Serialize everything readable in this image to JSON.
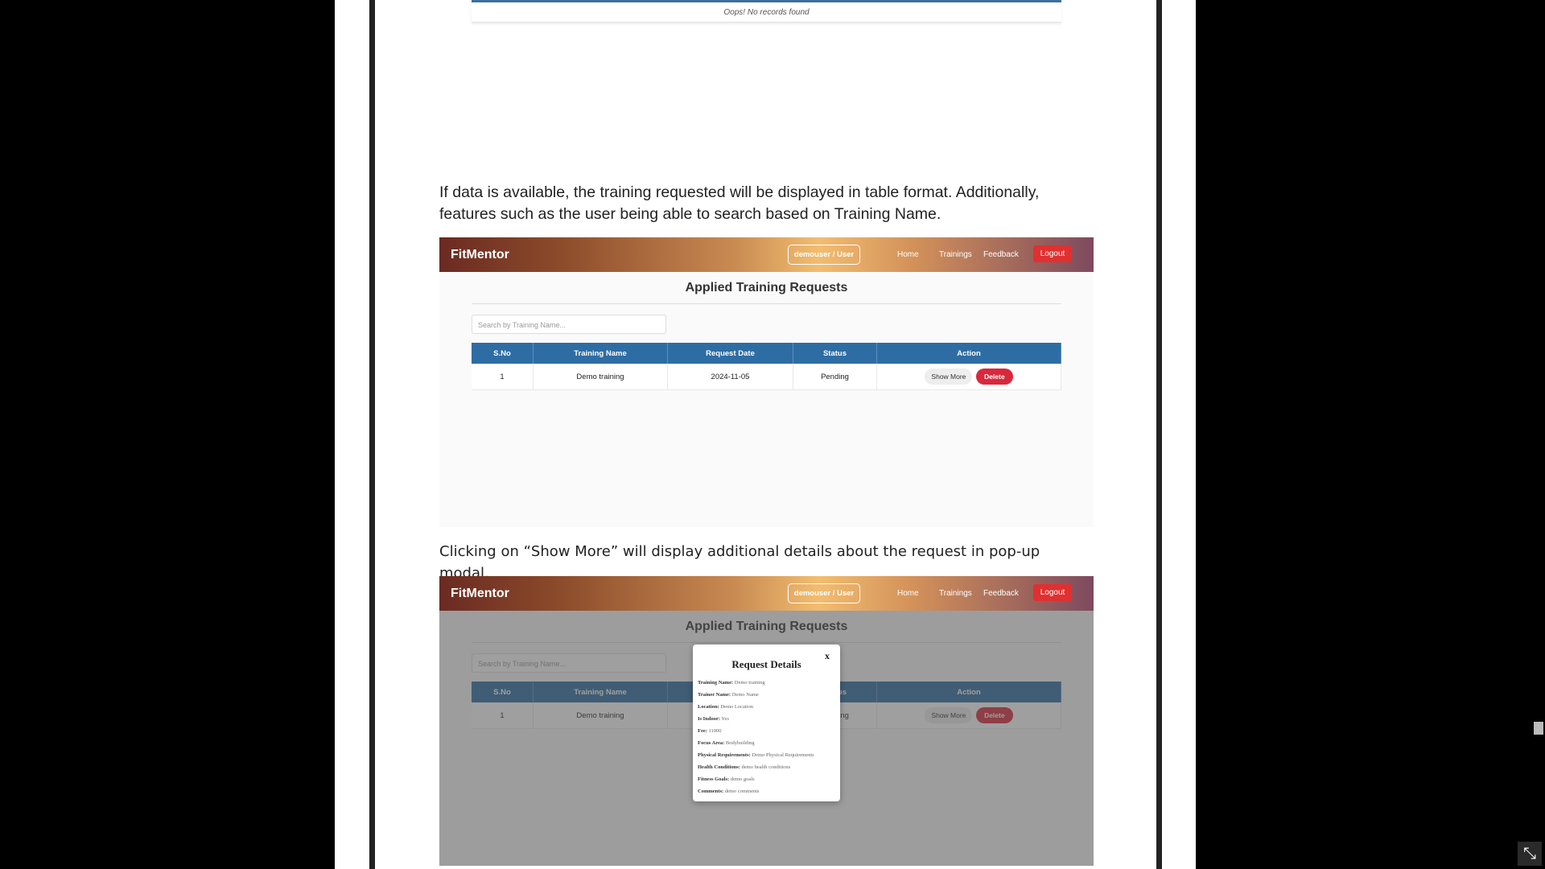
{
  "stub": {
    "text": "Oops! No records found"
  },
  "para1": "If data is available, the training requested will be displayed in table format. Additionally, features such as the user being able to search based on Training Name.",
  "para2": "Clicking on “Show More” will display additional details about the request in pop-up modal.",
  "app": {
    "brand": "FitMentor",
    "user_pill": "demouser / User",
    "nav": [
      "Home",
      "Trainings",
      "Feedback"
    ],
    "logout": "Logout",
    "page_title": "Applied Training Requests",
    "search_placeholder": "Search by Training Name...",
    "columns": [
      "S.No",
      "Training Name",
      "Request Date",
      "Status",
      "Action"
    ],
    "row": {
      "sno": "1",
      "training_name": "Demo training",
      "request_date": "2024-11-05",
      "status": "Pending",
      "show_more": "Show More",
      "delete": "Delete"
    }
  },
  "modal": {
    "close": "x",
    "title": "Request Details",
    "fields": [
      {
        "label": "Training Name:",
        "value": "Demo training"
      },
      {
        "label": "Trainer Name:",
        "value": "Demo Name"
      },
      {
        "label": "Location:",
        "value": "Demo Location"
      },
      {
        "label": "Is Indoor:",
        "value": "Yes"
      },
      {
        "label": "Fee:",
        "value": "11000"
      },
      {
        "label": "Focus Area:",
        "value": "Bodybuilding"
      },
      {
        "label": "Physical Requirements:",
        "value": "Demo Physical Requirements"
      },
      {
        "label": "Health Conditions:",
        "value": "demo health conditions"
      },
      {
        "label": "Fitness Goals:",
        "value": "demo goals"
      },
      {
        "label": "Comments:",
        "value": "demo comments"
      }
    ]
  },
  "colors": {
    "nav_start": "#6a2a22",
    "nav_mid": "#f2bd70",
    "table_header": "#2e6da4",
    "delete": "#d9283c",
    "logout": "#e03030"
  }
}
